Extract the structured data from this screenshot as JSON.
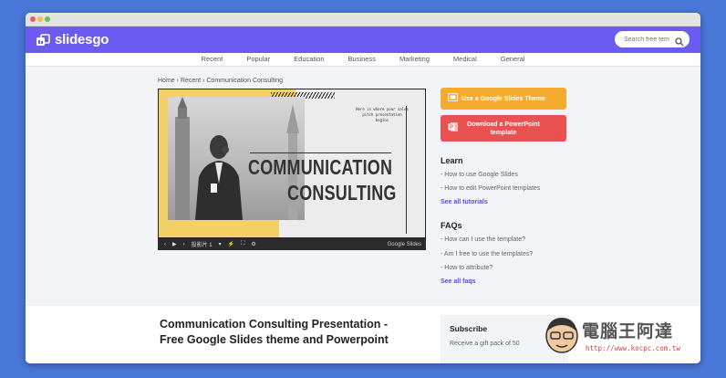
{
  "brand": {
    "name": "slidesgo"
  },
  "search": {
    "placeholder": "Search free tem"
  },
  "nav": [
    "Recent",
    "Popular",
    "Education",
    "Business",
    "Marketing",
    "Medical",
    "General"
  ],
  "breadcrumb": {
    "home": "Home",
    "sep": "›",
    "recent": "Recent",
    "current": "Communication Consulting"
  },
  "slide": {
    "note_line1": "Here is where your sales",
    "note_line2": "pitch presentation begins",
    "title_line1": "COMMUNICATION",
    "title_line2": "CONSULTING"
  },
  "player": {
    "slide_label": "投影片 1",
    "brand": "Google Slides"
  },
  "buttons": {
    "google": "Use a Google Slides Theme",
    "ppt_line1": "Download a PowerPoint",
    "ppt_line2": "template"
  },
  "learn": {
    "title": "Learn",
    "items": [
      "- How to use Google Slides",
      "- How to edit PowerPoint templates"
    ],
    "more": "See all tutorials"
  },
  "faqs": {
    "title": "FAQs",
    "items": [
      "- How can I use the template?",
      "- Am I free to use the templates?",
      "- How to attribute?"
    ],
    "more": "See all faqs"
  },
  "page": {
    "title_line1": "Communication Consulting Presentation -",
    "title_line2": "Free Google Slides theme and Powerpoint"
  },
  "subscribe": {
    "title": "Subscribe",
    "desc": "Receive a gift pack of 50"
  },
  "watermark": {
    "text": "電腦王阿達",
    "url": "http://www.kocpc.com.tw"
  },
  "colors": {
    "header": "#6b5bf0",
    "google_btn": "#f4ab2e",
    "ppt_btn": "#ea5252",
    "link": "#5a4bdc"
  }
}
